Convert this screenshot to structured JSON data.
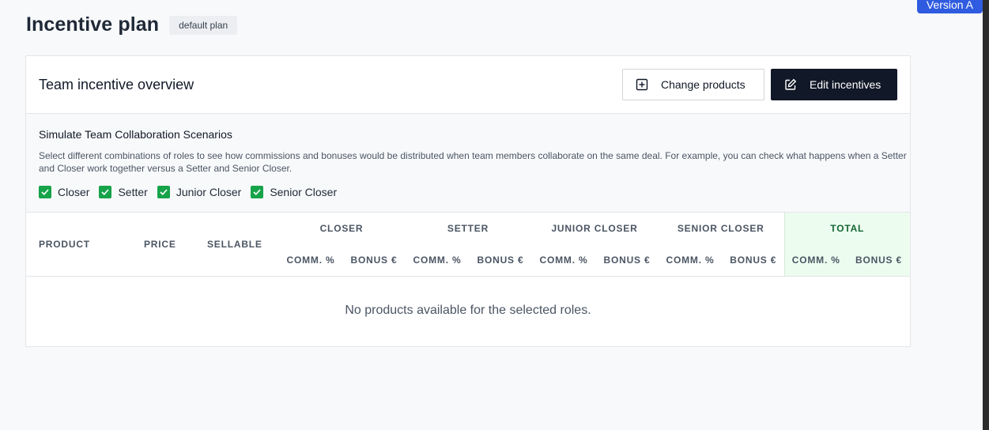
{
  "page": {
    "title": "Incentive plan",
    "plan_badge": "default plan",
    "version_badge": "Version A"
  },
  "card": {
    "title": "Team incentive overview",
    "change_products_label": "Change products",
    "edit_incentives_label": "Edit incentives"
  },
  "simulation": {
    "title": "Simulate Team Collaboration Scenarios",
    "description": "Select different combinations of roles to see how commissions and bonuses would be distributed when team members collaborate on the same deal. For example, you can check what happens when a Setter and Closer work together versus a Setter and Senior Closer.",
    "roles": [
      {
        "label": "Closer",
        "checked": true
      },
      {
        "label": "Setter",
        "checked": true
      },
      {
        "label": "Junior Closer",
        "checked": true
      },
      {
        "label": "Senior Closer",
        "checked": true
      }
    ]
  },
  "table": {
    "columns": {
      "product": "PRODUCT",
      "price": "PRICE",
      "sellable": "SELLABLE"
    },
    "groups": [
      "CLOSER",
      "SETTER",
      "JUNIOR CLOSER",
      "SENIOR CLOSER",
      "TOTAL"
    ],
    "sub_headers": {
      "comm": "COMM. %",
      "bonus": "BONUS €"
    },
    "empty_message": "No products available for the selected roles."
  },
  "colors": {
    "accent_dark": "#111827",
    "checkbox_green": "#16a34a",
    "total_bg": "#ecfdf0",
    "version_blue": "#2f5be0"
  }
}
